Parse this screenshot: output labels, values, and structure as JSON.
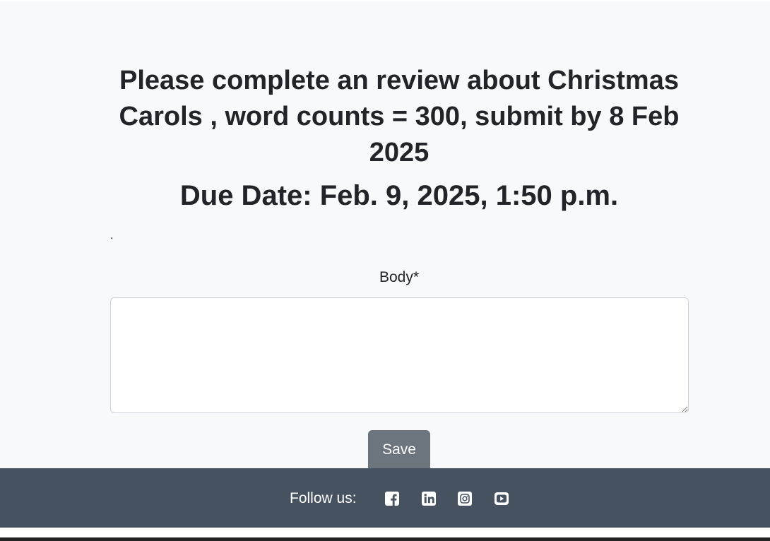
{
  "task": {
    "title": "Please complete an review about Christmas Carols , word counts = 300, submit by 8 Feb 2025",
    "due_date": "Due Date: Feb. 9, 2025, 1:50 p.m.",
    "dot": "."
  },
  "form": {
    "body_label": "Body*",
    "body_value": "",
    "save_label": "Save"
  },
  "footer": {
    "follow_label": "Follow us:",
    "social_icons": [
      "facebook-icon",
      "linkedin-icon",
      "instagram-icon",
      "youtube-icon"
    ]
  },
  "colors": {
    "page_background": "#f8f9fa",
    "footer_background": "#475260",
    "button_background": "#6c757d",
    "text": "#212529"
  }
}
